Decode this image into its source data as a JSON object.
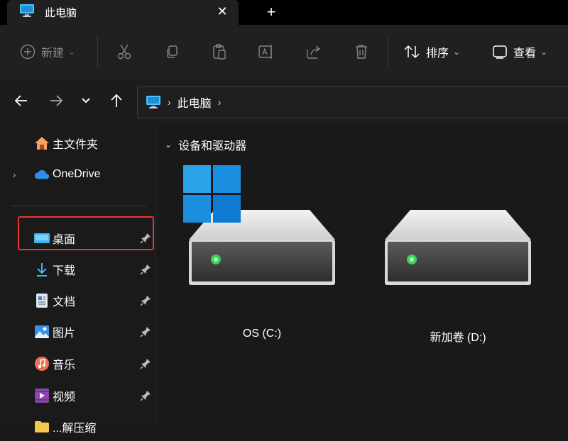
{
  "tab": {
    "title": "此电脑",
    "close_icon": "close-icon",
    "new_tab_icon": "plus-icon"
  },
  "toolbar": {
    "new_label": "新建",
    "sort_label": "排序",
    "view_label": "查看",
    "icons": [
      "cut-icon",
      "copy-icon",
      "paste-icon",
      "rename-icon",
      "share-icon",
      "delete-icon"
    ]
  },
  "address": {
    "crumb": "此电脑"
  },
  "sidebar": {
    "items": [
      {
        "label": "主文件夹"
      },
      {
        "label": "OneDrive"
      },
      {
        "label": "桌面"
      },
      {
        "label": "下载"
      },
      {
        "label": "文档"
      },
      {
        "label": "图片"
      },
      {
        "label": "音乐"
      },
      {
        "label": "视频"
      },
      {
        "label": "...解压缩"
      }
    ]
  },
  "content": {
    "section_title": "设备和驱动器",
    "drives": [
      {
        "name": "OS (C:)"
      },
      {
        "name": "新加卷 (D:)"
      }
    ]
  },
  "colors": {
    "accent": "#4cc2ff",
    "highlight_border": "#e33333",
    "drive_led": "#39d353"
  }
}
